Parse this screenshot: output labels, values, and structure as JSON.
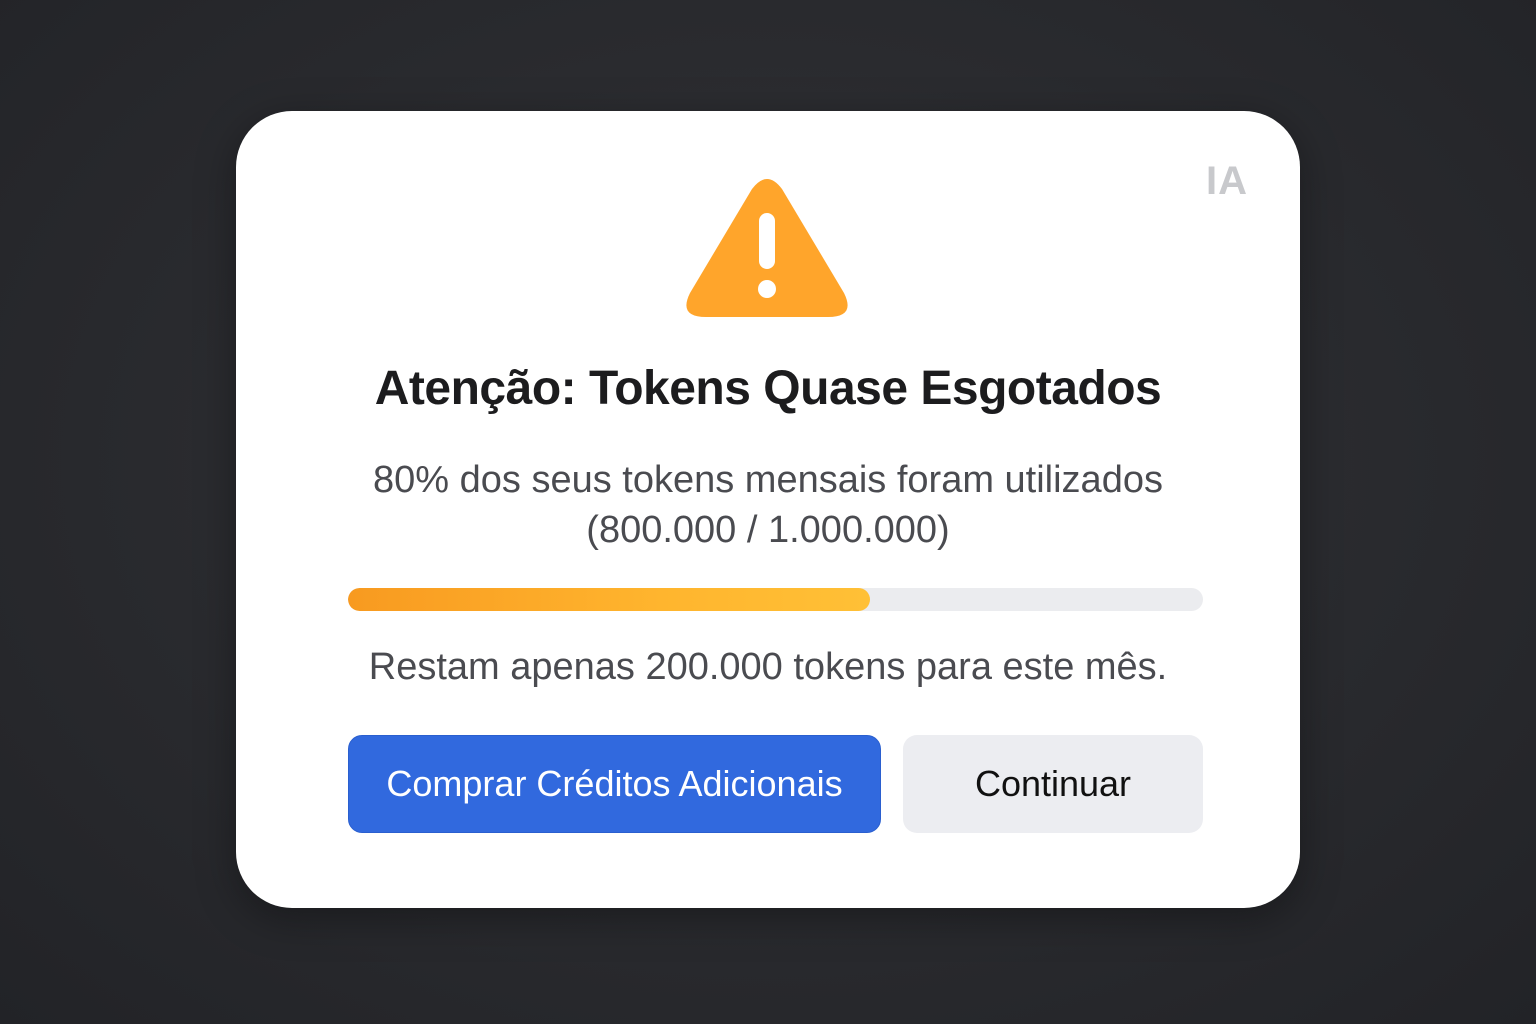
{
  "modal": {
    "badge": "IA",
    "icon": "warning-triangle-icon",
    "title": "Atenção: Tokens Quase Esgotados",
    "description": "80% dos seus tokens mensais foram utilizados (800.000 / 1.000.000)",
    "progress": {
      "used": 800000,
      "total": 1000000,
      "fill_fraction_shown": 0.61
    },
    "remaining_text": "Restam apenas 200.000 tokens para este mês.",
    "buttons": {
      "buy_label": "Comprar Créditos Adicionais",
      "continue_label": "Continuar"
    }
  },
  "colors": {
    "warning": "#FFA52B",
    "primary_button": "#3169DE",
    "secondary_button": "#ECEDF1",
    "progress_track": "#EBECEF"
  }
}
